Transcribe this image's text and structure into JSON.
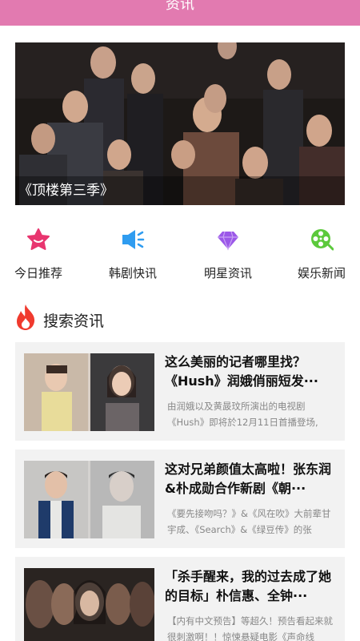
{
  "header": {
    "title": "资讯"
  },
  "banner": {
    "caption": "《顶楼第三季》"
  },
  "quick_nav": [
    {
      "label": "今日推荐",
      "icon": "star-icon",
      "color": "#e8356f"
    },
    {
      "label": "韩剧快讯",
      "icon": "megaphone-icon",
      "color": "#2f9cf0"
    },
    {
      "label": "明星资讯",
      "icon": "diamond-icon",
      "color": "#9b58e8"
    },
    {
      "label": "娱乐新闻",
      "icon": "film-reel-icon",
      "color": "#5cc93c"
    }
  ],
  "section": {
    "title": "搜索资讯",
    "icon": "flame-icon",
    "icon_color": "#f03a2e"
  },
  "articles": [
    {
      "title": "这么美丽的记者哪里找？《Hush》润娥俏丽短发···",
      "desc": "由润娥以及黄晸玟所演出的电视剧《Hush》即将於12月11日首播登场,"
    },
    {
      "title": "这对兄弟颜值太高啦！张东润&朴成勋合作新剧《朝···",
      "desc": "《要先接吻吗？》&《风在吹》大前辈甘宇成、《Search》&《绿豆传》的张"
    },
    {
      "title": "「杀手醒来，我的过去成了她的目标」朴信惠、全钟···",
      "desc": "【内有中文预告】等超久！预告看起来就很刺激啊！！惊悚悬疑电影《声命线"
    }
  ]
}
